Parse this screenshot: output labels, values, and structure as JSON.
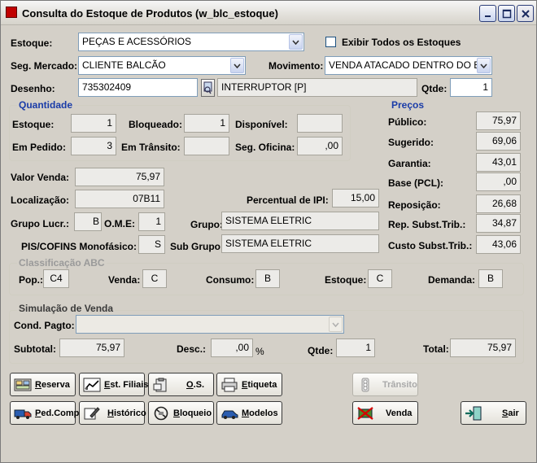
{
  "window": {
    "title": "Consulta do Estoque de Produtos (w_blc_estoque)"
  },
  "header": {
    "estoque_label": "Estoque:",
    "estoque_value": "PEÇAS E ACESSÓRIOS",
    "exibir_label": "Exibir Todos os Estoques",
    "segmercado_label": "Seg. Mercado:",
    "segmercado_value": "CLIENTE BALCÃO",
    "movimento_label": "Movimento:",
    "movimento_value": "VENDA ATACADO DENTRO DO E",
    "desenho_label": "Desenho:",
    "desenho_value": "735302409",
    "descricao_value": "INTERRUPTOR [P]",
    "qtde_label": "Qtde:",
    "qtde_value": "1"
  },
  "quantidade": {
    "title": "Quantidade",
    "estoque_label": "Estoque:",
    "estoque_value": "1",
    "bloqueado_label": "Bloqueado:",
    "bloqueado_value": "1",
    "disponivel_label": "Disponível:",
    "disponivel_value": "",
    "empedido_label": "Em Pedido:",
    "empedido_value": "3",
    "emtransito_label": "Em Trânsito:",
    "emtransito_value": "",
    "segoficina_label": "Seg. Oficina:",
    "segoficina_value": ",00"
  },
  "precos": {
    "title": "Preços",
    "rows": [
      {
        "label": "Público:",
        "value": "75,97"
      },
      {
        "label": "Sugerido:",
        "value": "69,06"
      },
      {
        "label": "Garantia:",
        "value": "43,01"
      },
      {
        "label": "Base (PCL):",
        "value": ",00"
      },
      {
        "label": "Reposição:",
        "value": "26,68"
      },
      {
        "label": "Rep. Subst.Trib.:",
        "value": "34,87"
      },
      {
        "label": "Custo Subst.Trib.:",
        "value": "43,06"
      }
    ]
  },
  "detalhes": {
    "valorvenda_label": "Valor Venda:",
    "valorvenda_value": "75,97",
    "localizacao_label": "Localização:",
    "localizacao_value": "07B11",
    "percipi_label": "Percentual de IPI:",
    "percipi_value": "15,00",
    "grupolucr_label": "Grupo Lucr.:",
    "grupolucr_value": "B",
    "ome_label": "O.M.E:",
    "ome_value": "1",
    "grupo_label": "Grupo:",
    "grupo_value": "SISTEMA ELETRIC",
    "piscofins_label": "PIS/COFINS Monofásico:",
    "piscofins_value": "S",
    "subgrupo_label": "Sub Grupo:",
    "subgrupo_value": "SISTEMA ELETRIC"
  },
  "abc": {
    "title": "Classificação ABC",
    "pop_label": "Pop.:",
    "pop_value": "C4",
    "venda_label": "Venda:",
    "venda_value": "C",
    "consumo_label": "Consumo:",
    "consumo_value": "B",
    "estoque_label": "Estoque:",
    "estoque_value": "C",
    "demanda_label": "Demanda:",
    "demanda_value": "B"
  },
  "simulacao": {
    "title": "Simulação de Venda",
    "condpagto_label": "Cond. Pagto:",
    "condpagto_value": "",
    "subtotal_label": "Subtotal:",
    "subtotal_value": "75,97",
    "desc_label": "Desc.:",
    "desc_value": ",00",
    "desc_unit": "%",
    "qtde_label": "Qtde:",
    "qtde_value": "1",
    "total_label": "Total:",
    "total_value": "75,97"
  },
  "buttons": {
    "reserva": {
      "mnemonic": "R",
      "rest": "eserva"
    },
    "estfiliais": {
      "mnemonic": "E",
      "rest": "st. Filiais"
    },
    "os": {
      "mnemonic": "O",
      "rest": ".S."
    },
    "etiqueta": {
      "mnemonic": "E",
      "rest": "tiqueta"
    },
    "transito": {
      "label": "Trânsito"
    },
    "pedcomp": {
      "mnemonic": "P",
      "rest": "ed.Comp"
    },
    "historico": {
      "mnemonic": "H",
      "rest": "istórico"
    },
    "bloqueio": {
      "mnemonic": "B",
      "rest": "loqueio"
    },
    "modelos": {
      "mnemonic": "M",
      "rest": "odelos"
    },
    "venda": {
      "label": "Venda"
    },
    "sair": {
      "mnemonic": "S",
      "rest": "air"
    }
  }
}
